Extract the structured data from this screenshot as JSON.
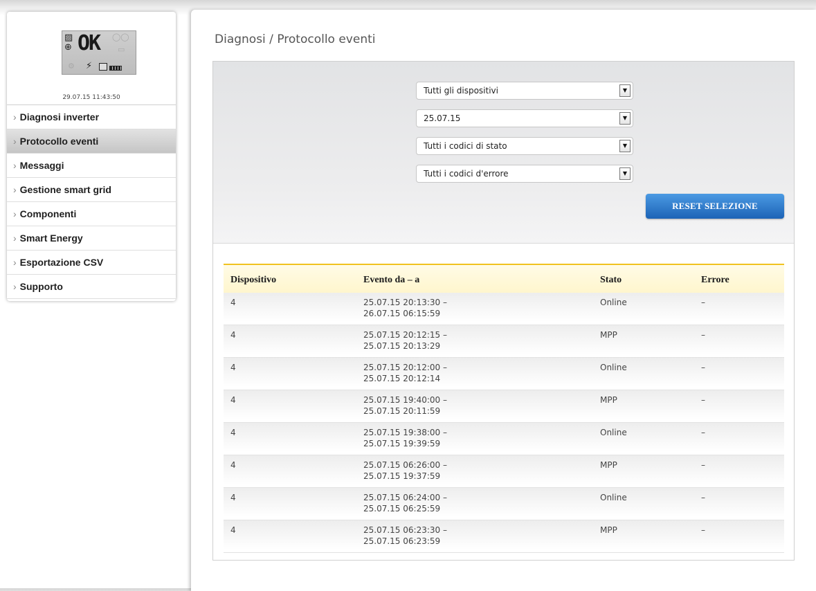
{
  "display": {
    "status_text": "OK",
    "timestamp": "29.07.15 11:43:50"
  },
  "sidebar": {
    "items": [
      {
        "label": "Diagnosi inverter",
        "active": false
      },
      {
        "label": "Protocollo eventi",
        "active": true
      },
      {
        "label": "Messaggi",
        "active": false
      },
      {
        "label": "Gestione smart grid",
        "active": false
      },
      {
        "label": "Componenti",
        "active": false
      },
      {
        "label": "Smart Energy",
        "active": false
      },
      {
        "label": "Esportazione CSV",
        "active": false
      },
      {
        "label": "Supporto",
        "active": false
      }
    ]
  },
  "page": {
    "title": "Diagnosi / Protocollo eventi"
  },
  "filters": {
    "device": "Tutti gli dispositivi",
    "date": "25.07.15",
    "status_code": "Tutti i codici di stato",
    "error_code": "Tutti i codici d'errore",
    "reset_label": "RESET SELEZIONE"
  },
  "table": {
    "headers": [
      "Dispositivo",
      "Evento da – a",
      "Stato",
      "Errore"
    ],
    "rows": [
      {
        "device": "4",
        "from": "25.07.15 20:13:30 –",
        "to": "26.07.15 06:15:59",
        "status": "Online",
        "error": "–"
      },
      {
        "device": "4",
        "from": "25.07.15 20:12:15 –",
        "to": "25.07.15 20:13:29",
        "status": "MPP",
        "error": "–"
      },
      {
        "device": "4",
        "from": "25.07.15 20:12:00 –",
        "to": "25.07.15 20:12:14",
        "status": "Online",
        "error": "–"
      },
      {
        "device": "4",
        "from": "25.07.15 19:40:00 –",
        "to": "25.07.15 20:11:59",
        "status": "MPP",
        "error": "–"
      },
      {
        "device": "4",
        "from": "25.07.15 19:38:00 –",
        "to": "25.07.15 19:39:59",
        "status": "Online",
        "error": "–"
      },
      {
        "device": "4",
        "from": "25.07.15 06:26:00 –",
        "to": "25.07.15 19:37:59",
        "status": "MPP",
        "error": "–"
      },
      {
        "device": "4",
        "from": "25.07.15 06:24:00 –",
        "to": "25.07.15 06:25:59",
        "status": "Online",
        "error": "–"
      },
      {
        "device": "4",
        "from": "25.07.15 06:23:30 –",
        "to": "25.07.15 06:23:59",
        "status": "MPP",
        "error": "–"
      }
    ]
  },
  "icons": {
    "select_arrow": "chevron-down-icon",
    "nav_chevron": "chevron-right-icon"
  }
}
